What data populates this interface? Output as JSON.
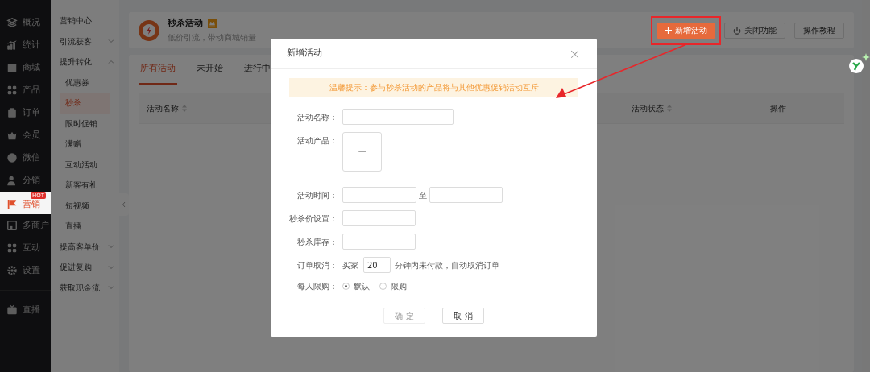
{
  "sidebar": {
    "items": [
      {
        "label": "概况",
        "selected": false
      },
      {
        "label": "统计",
        "selected": false
      },
      {
        "label": "商城",
        "selected": false
      },
      {
        "label": "产品",
        "selected": false
      },
      {
        "label": "订单",
        "selected": false
      },
      {
        "label": "会员",
        "selected": false
      },
      {
        "label": "微信",
        "selected": false
      },
      {
        "label": "分销",
        "selected": false
      },
      {
        "label": "营销",
        "selected": true,
        "badge": "HOT"
      },
      {
        "label": "多商户",
        "selected": false
      },
      {
        "label": "互动",
        "selected": false
      },
      {
        "label": "设置",
        "selected": false
      },
      {
        "label": "直播",
        "selected": false,
        "divider_before": true
      }
    ]
  },
  "submenu": {
    "items": [
      {
        "label": "营销中心"
      },
      {
        "label": "引流获客",
        "expanded": false
      },
      {
        "label": "提升转化",
        "expanded": true,
        "children": [
          {
            "label": "优惠券",
            "selected": false
          },
          {
            "label": "秒杀",
            "selected": true
          },
          {
            "label": "限时促销",
            "selected": false
          },
          {
            "label": "满赠",
            "selected": false
          },
          {
            "label": "互动活动",
            "selected": false
          },
          {
            "label": "新客有礼",
            "selected": false
          },
          {
            "label": "短视频",
            "selected": false
          },
          {
            "label": "直播",
            "selected": false
          }
        ]
      },
      {
        "label": "提高客单价",
        "expanded": false
      },
      {
        "label": "促进复购",
        "expanded": false
      },
      {
        "label": "获取现金流",
        "expanded": false
      }
    ]
  },
  "header": {
    "title": "秒杀活动",
    "subtitle": "低价引流，带动商城销量",
    "buttons": [
      {
        "kind": "primary",
        "label": "新增活动",
        "highlighted": true
      },
      {
        "kind": "power",
        "label": "关闭功能",
        "highlighted": false
      },
      {
        "kind": "plain",
        "label": "操作教程",
        "highlighted": false
      }
    ]
  },
  "tabs": [
    {
      "label": "所有活动",
      "selected": true
    },
    {
      "label": "未开始",
      "selected": false
    },
    {
      "label": "进行中",
      "selected": false
    }
  ],
  "table": {
    "columns": [
      {
        "label": "活动名称",
        "sortable": true
      },
      {
        "label": "活动状态",
        "sortable": true
      },
      {
        "label": "操作",
        "sortable": false
      }
    ]
  },
  "dialog": {
    "title": "新增活动",
    "close": "×",
    "notice": "温馨提示：参与秒杀活动的产品将与其他优惠促销活动互斥",
    "fields": [
      {
        "kind": "text",
        "label": "活动名称："
      },
      {
        "kind": "upload",
        "label": "活动产品：",
        "icon_text": "+"
      },
      {
        "kind": "range",
        "label": "活动时间：",
        "separator": "至"
      },
      {
        "kind": "short",
        "label": "秒杀价设置："
      },
      {
        "kind": "short",
        "label": "秒杀库存："
      },
      {
        "kind": "inline",
        "label": "订单取消：",
        "prefix": "买家",
        "value": "20",
        "suffix": "分钟内未付款，自动取消订单"
      },
      {
        "kind": "radio",
        "label": "每人限购：",
        "options": [
          {
            "label": "默认",
            "selected": true
          },
          {
            "label": "限购",
            "selected": false
          }
        ]
      }
    ],
    "buttons": [
      {
        "label": "确 定",
        "disabled": true
      },
      {
        "label": "取 消",
        "disabled": false
      }
    ]
  }
}
